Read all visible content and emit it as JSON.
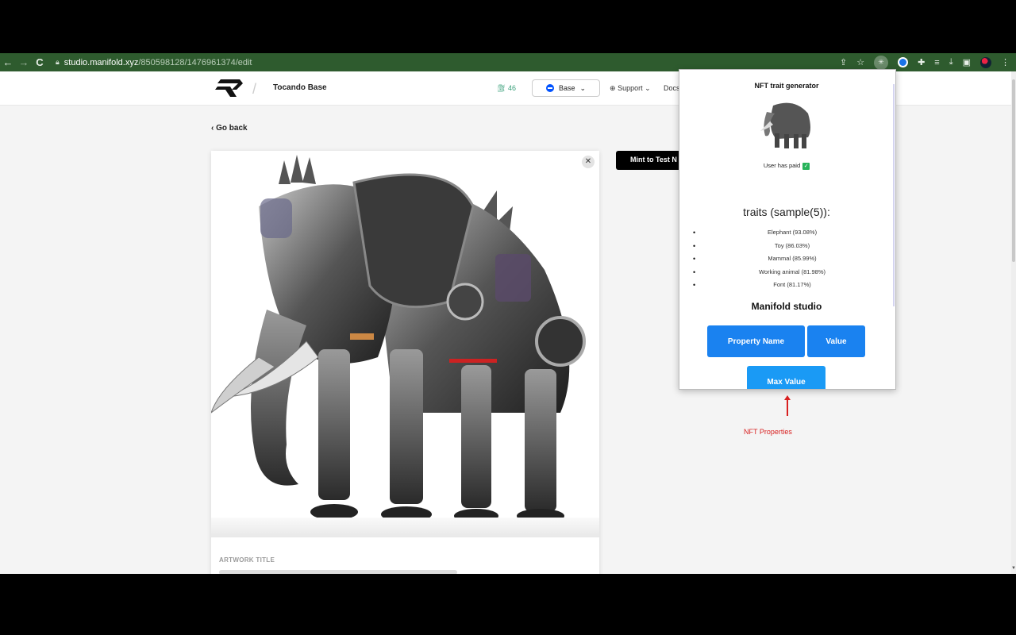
{
  "browser": {
    "url_host": "studio.manifold.xyz",
    "url_path": "/850598128/1476961374/edit",
    "back_icon": "←",
    "forward_icon": "→",
    "reload_icon": "C"
  },
  "header": {
    "project_name": "Tocando Base",
    "gas_value": "46",
    "network_label": "Base",
    "support_label": "Support",
    "docs_label": "Docs"
  },
  "main": {
    "go_back_label": "Go back",
    "mint_button_label": "Mint to Test N",
    "close_icon": "✕",
    "artwork_title_label": "ARTWORK TITLE"
  },
  "popup": {
    "title": "NFT trait generator",
    "paid_label": "User has paid",
    "check_icon": "✓",
    "traits_heading": "traits (sample(5)):",
    "traits": [
      "Elephant (93.08%)",
      "Toy (86.03%)",
      "Mammal (85.99%)",
      "Working animal (81.98%)",
      "Font (81.17%)"
    ],
    "section_title": "Manifold studio",
    "buttons": {
      "property_name": "Property Name",
      "value": "Value",
      "max_value": "Max Value"
    }
  },
  "annotation": {
    "label": "NFT Properties",
    "color": "#d82020"
  },
  "colors": {
    "toolbar_bg": "#2e5b2e",
    "primary_button": "#1a82f0",
    "mint_button": "#000000"
  }
}
